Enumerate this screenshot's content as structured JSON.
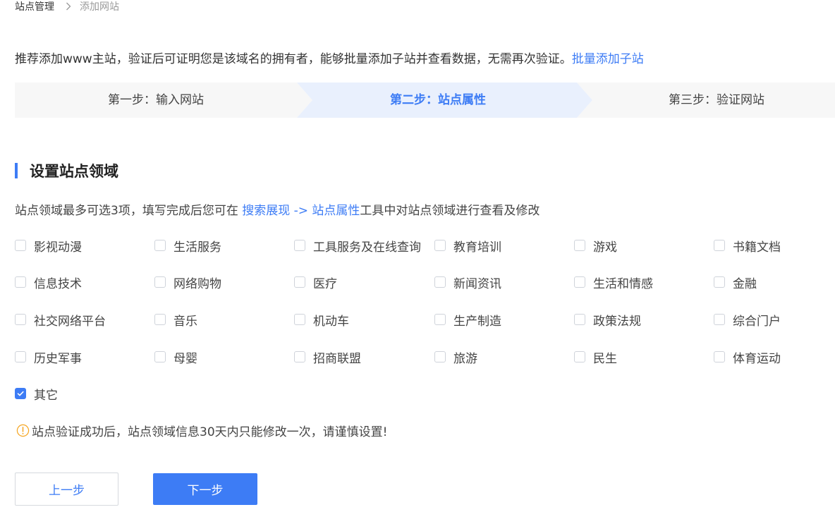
{
  "breadcrumb": {
    "root": "站点管理",
    "current": "添加网站"
  },
  "intro": {
    "text": "推荐添加www主站，验证后可证明您是该域名的拥有者，能够批量添加子站并查看数据，无需再次验证。",
    "link": "批量添加子站"
  },
  "steps": [
    {
      "label": "第一步：输入网站",
      "active": false
    },
    {
      "label": "第二步：站点属性",
      "active": true
    },
    {
      "label": "第三步：验证网站",
      "active": false
    }
  ],
  "section": {
    "title": "设置站点领域"
  },
  "hint": {
    "prefix": "站点领域最多可选3项，填写完成后您可在 ",
    "link": "搜索展现 -> 站点属性",
    "suffix": "工具中对站点领域进行查看及修改"
  },
  "categories": [
    {
      "label": "影视动漫",
      "checked": false
    },
    {
      "label": "生活服务",
      "checked": false
    },
    {
      "label": "工具服务及在线查询",
      "checked": false
    },
    {
      "label": "教育培训",
      "checked": false
    },
    {
      "label": "游戏",
      "checked": false
    },
    {
      "label": "书籍文档",
      "checked": false
    },
    {
      "label": "信息技术",
      "checked": false
    },
    {
      "label": "网络购物",
      "checked": false
    },
    {
      "label": "医疗",
      "checked": false
    },
    {
      "label": "新闻资讯",
      "checked": false
    },
    {
      "label": "生活和情感",
      "checked": false
    },
    {
      "label": "金融",
      "checked": false
    },
    {
      "label": "社交网络平台",
      "checked": false
    },
    {
      "label": "音乐",
      "checked": false
    },
    {
      "label": "机动车",
      "checked": false
    },
    {
      "label": "生产制造",
      "checked": false
    },
    {
      "label": "政策法规",
      "checked": false
    },
    {
      "label": "综合门户",
      "checked": false
    },
    {
      "label": "历史军事",
      "checked": false
    },
    {
      "label": "母婴",
      "checked": false
    },
    {
      "label": "招商联盟",
      "checked": false
    },
    {
      "label": "旅游",
      "checked": false
    },
    {
      "label": "民生",
      "checked": false
    },
    {
      "label": "体育运动",
      "checked": false
    },
    {
      "label": "其它",
      "checked": true
    }
  ],
  "warning": {
    "text": "站点验证成功后，站点领域信息30天内只能修改一次，请谨慎设置!"
  },
  "buttons": {
    "prev": "上一步",
    "next": "下一步"
  },
  "icons": {
    "breadcrumb_separator": "chevron-right-icon",
    "warning": "exclamation-circle-icon",
    "checked": "check-icon"
  },
  "colors": {
    "accent": "#3d7cf5",
    "warning": "#f5a623",
    "step_bg": "#f7f7f7",
    "step_active_bg": "#e9f0fd"
  }
}
